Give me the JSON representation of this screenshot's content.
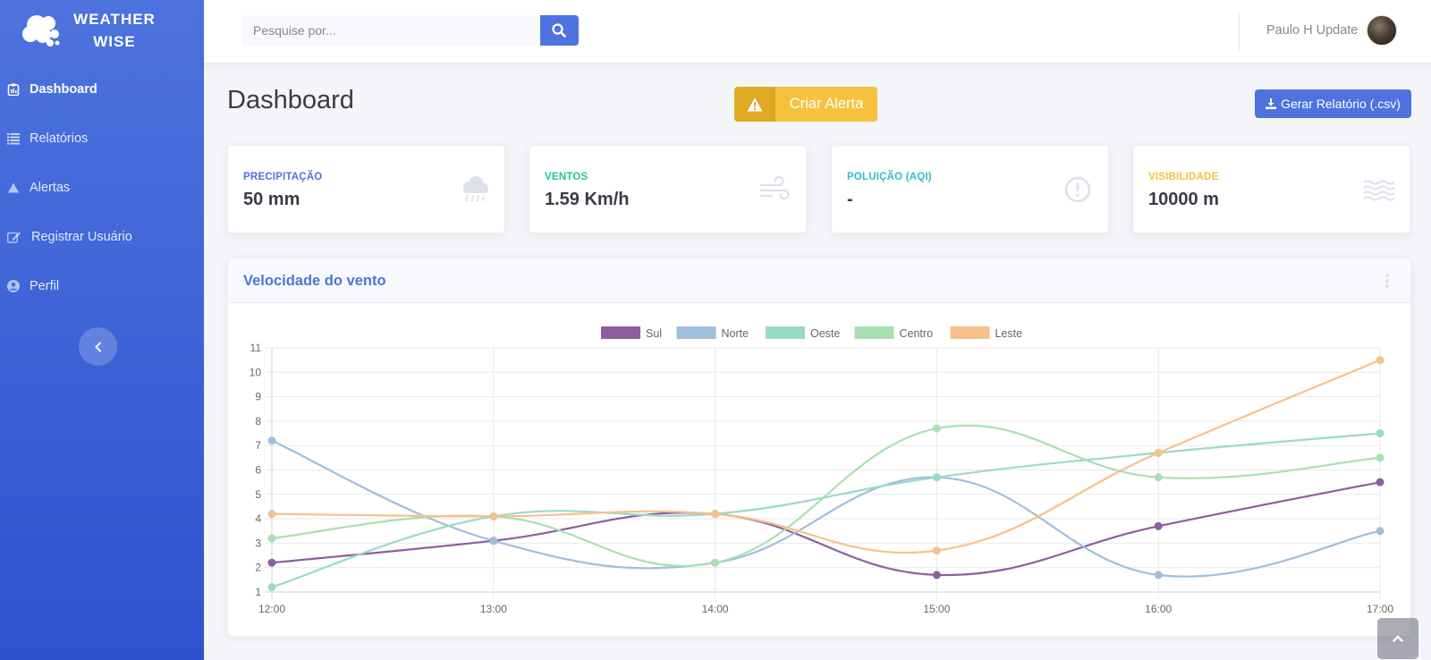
{
  "brand": {
    "line1": "WEATHER",
    "line2": "WISE"
  },
  "sidebar": {
    "items": [
      {
        "label": "Dashboard",
        "icon": "clipboard-icon"
      },
      {
        "label": "Relatórios",
        "icon": "list-icon"
      },
      {
        "label": "Alertas",
        "icon": "warning-icon"
      },
      {
        "label": "Registrar Usuário",
        "icon": "edit-icon"
      },
      {
        "label": "Perfil",
        "icon": "user-circle-icon"
      }
    ]
  },
  "search": {
    "placeholder": "Pesquise por..."
  },
  "user": {
    "name": "Paulo H Update"
  },
  "page": {
    "title": "Dashboard",
    "alert_button": "Criar Alerta",
    "report_button": "Gerar Relatório (.csv)"
  },
  "cards": [
    {
      "label": "PRECIPITAÇÃO",
      "value": "50 mm",
      "color": "#4e73df",
      "icon": "cloud-rain-icon"
    },
    {
      "label": "VENTOS",
      "value": "1.59 Km/h",
      "color": "#1cc88a",
      "icon": "wind-icon"
    },
    {
      "label": "POLUIÇÃO (AQI)",
      "value": "-",
      "color": "#36b9cc",
      "icon": "exclamation-circle-icon"
    },
    {
      "label": "VISIBILIDADE",
      "value": "10000 m",
      "color": "#f6c23e",
      "icon": "water-icon"
    }
  ],
  "colors": {
    "primary": "#4e73df",
    "warning": "#f6c23e"
  },
  "chart_data": {
    "type": "line",
    "title": "Velocidade do vento",
    "x": [
      "12:00",
      "13:00",
      "14:00",
      "15:00",
      "16:00",
      "17:00"
    ],
    "ylim": [
      1,
      11
    ],
    "yticks": [
      1,
      2,
      3,
      4,
      5,
      6,
      7,
      8,
      9,
      10,
      11
    ],
    "grid": true,
    "legend_position": "top",
    "series": [
      {
        "name": "Sul",
        "color": "#8e5ea2",
        "values": [
          2.2,
          3.1,
          4.2,
          1.7,
          3.7,
          5.5
        ]
      },
      {
        "name": "Norte",
        "color": "#a0bedc",
        "values": [
          7.2,
          3.1,
          2.2,
          5.7,
          1.7,
          3.5
        ]
      },
      {
        "name": "Oeste",
        "color": "#9adac9",
        "values": [
          1.2,
          4.1,
          4.2,
          5.7,
          6.7,
          7.5
        ]
      },
      {
        "name": "Centro",
        "color": "#a8e0b0",
        "values": [
          3.2,
          4.1,
          2.2,
          7.7,
          5.7,
          6.5
        ]
      },
      {
        "name": "Leste",
        "color": "#f8c08a",
        "values": [
          4.2,
          4.1,
          4.2,
          2.7,
          6.7,
          10.5
        ]
      }
    ]
  }
}
